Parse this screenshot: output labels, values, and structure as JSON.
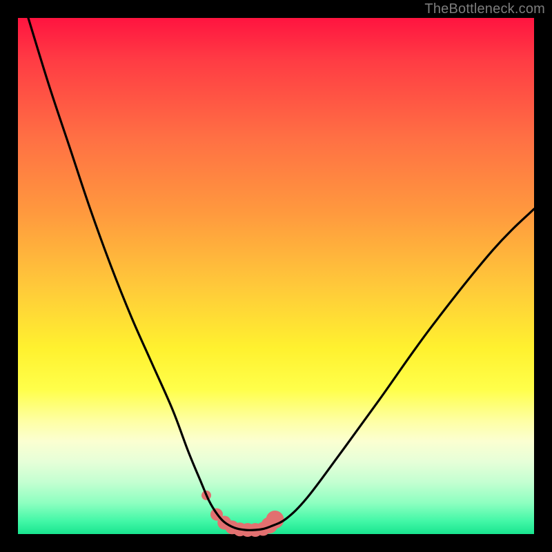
{
  "watermark": "TheBottleneck.com",
  "chart_data": {
    "type": "line",
    "title": "",
    "xlabel": "",
    "ylabel": "",
    "xlim": [
      0,
      100
    ],
    "ylim": [
      0,
      100
    ],
    "series": [
      {
        "name": "bottleneck-curve",
        "x": [
          2,
          6,
          10,
          14,
          18,
          22,
          26,
          30,
          33,
          35.5,
          37,
          38.5,
          40,
          42,
          44,
          46,
          47.5,
          49,
          52,
          56,
          62,
          70,
          80,
          92,
          100
        ],
        "values": [
          100,
          87,
          75,
          63,
          52,
          42,
          33,
          24,
          16,
          10,
          6.5,
          4,
          2.3,
          1.2,
          0.8,
          0.8,
          1.0,
          1.5,
          3,
          7,
          15,
          26,
          40,
          55,
          63
        ]
      }
    ],
    "markers": {
      "name": "trough-markers",
      "color": "#e27070",
      "points_x": [
        36.5,
        38.5,
        40,
        41.5,
        43,
        44.5,
        46,
        47.5,
        48.7,
        49.8
      ],
      "points_y": [
        7.5,
        3.8,
        2.2,
        1.3,
        0.9,
        0.8,
        0.8,
        1.0,
        1.7,
        2.8
      ],
      "radii": [
        7,
        9,
        10,
        10,
        10,
        10,
        10,
        10,
        12,
        13
      ]
    }
  }
}
